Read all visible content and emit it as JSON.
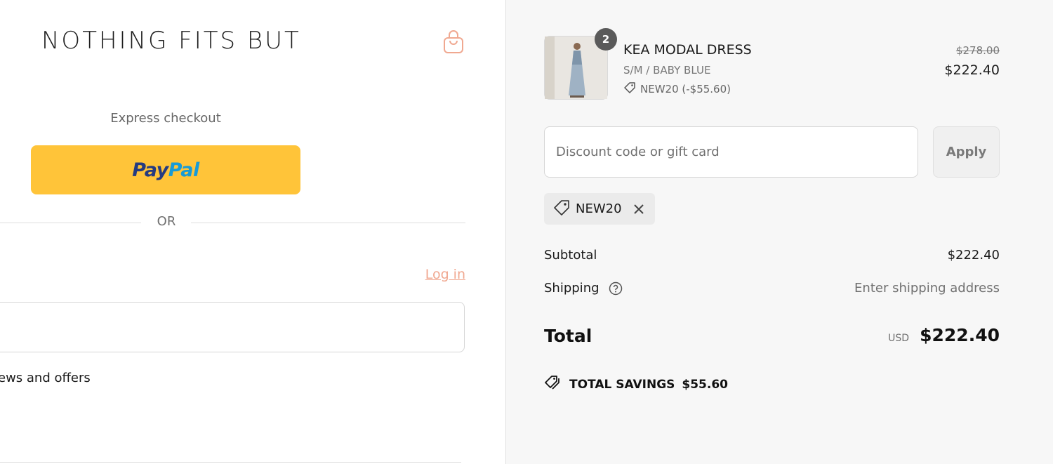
{
  "brand": {
    "name": "NOTHING FITS BUT"
  },
  "express": {
    "label": "Express checkout",
    "paypal_a": "Pay",
    "paypal_b": "Pal"
  },
  "divider": {
    "or": "OR"
  },
  "contact": {
    "login_link": "Log in",
    "email_value": "",
    "news_checkbox_label": "ews and offers"
  },
  "cart": {
    "item": {
      "name": "KEA MODAL DRESS",
      "variant": "S/M / BABY BLUE",
      "quantity": "2",
      "discount": "NEW20 (-$55.60)",
      "original_price": "$278.00",
      "price": "$222.40"
    },
    "discount_field": {
      "placeholder": "Discount code or gift card",
      "apply_label": "Apply"
    },
    "applied_code": "NEW20",
    "subtotal_label": "Subtotal",
    "subtotal_value": "$222.40",
    "shipping_label": "Shipping",
    "shipping_value": "Enter shipping address",
    "total_label": "Total",
    "currency": "USD",
    "total_value": "$222.40",
    "savings_label": "TOTAL SAVINGS",
    "savings_value": "$55.60"
  },
  "colors": {
    "paypal_yellow": "#ffc439",
    "accent": "#f0a890",
    "panel_bg": "#f7f7f7"
  }
}
